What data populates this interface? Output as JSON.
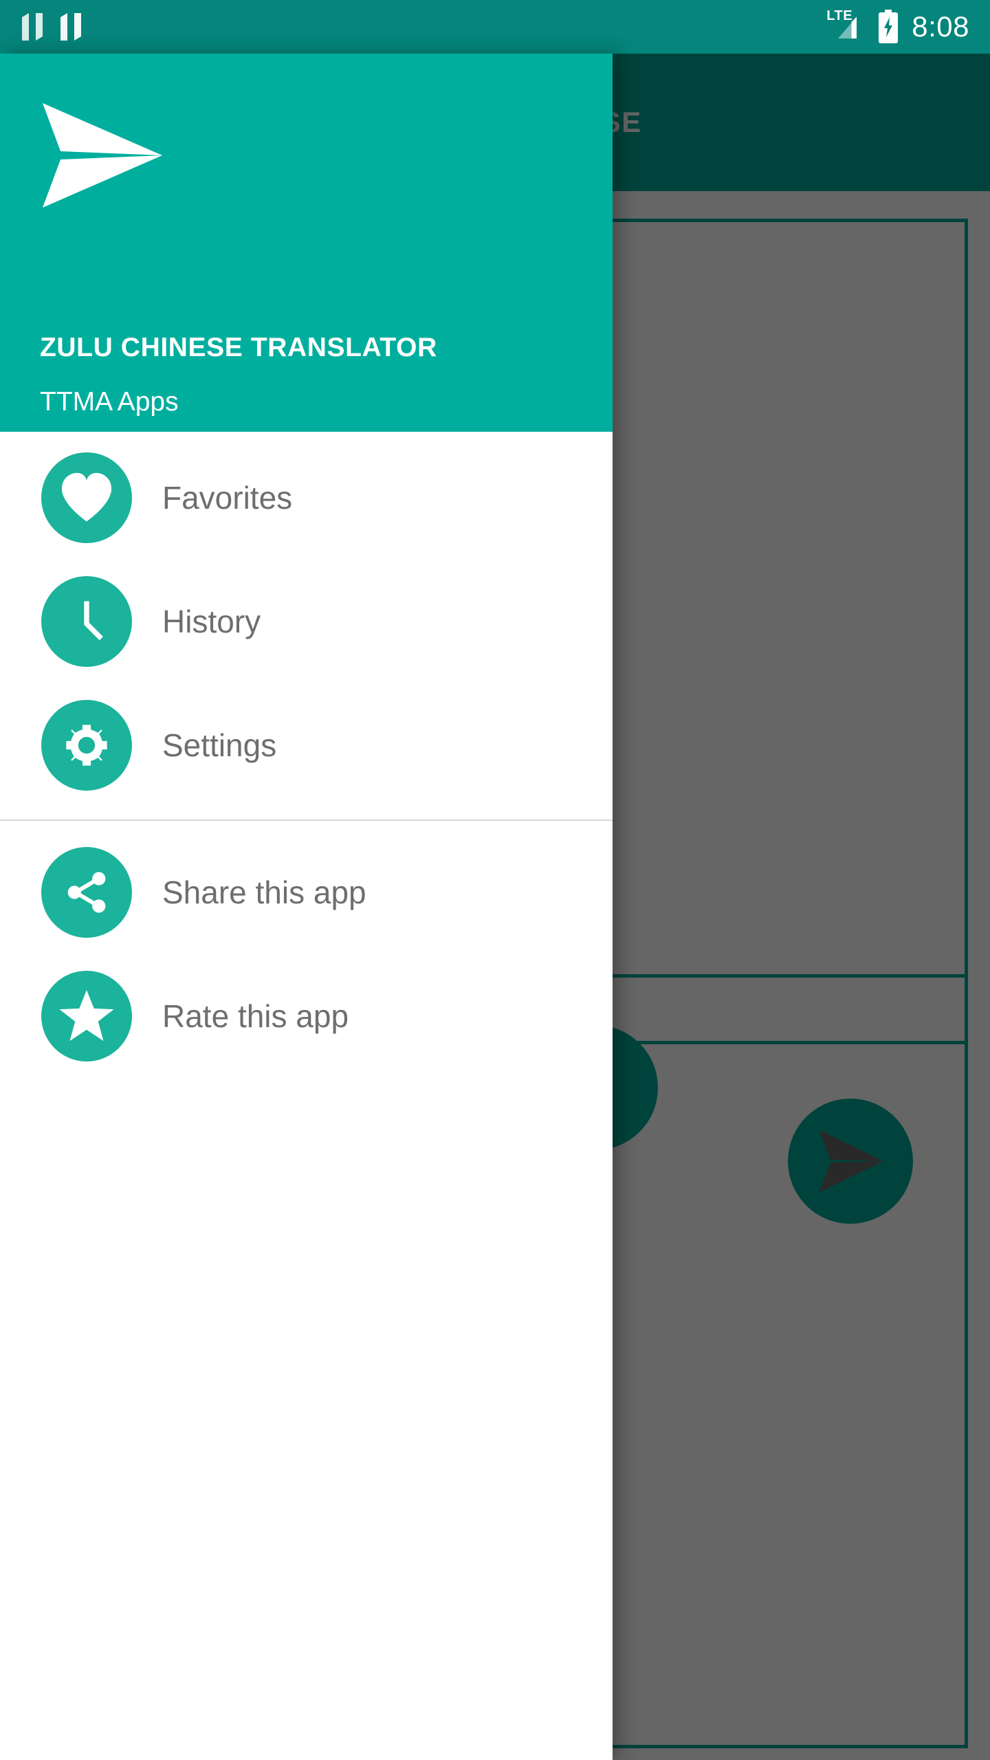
{
  "status_bar": {
    "notification_icons": [
      "android-n-icon",
      "android-n-icon"
    ],
    "network_label": "LTE",
    "battery_icon": "battery-charging-icon",
    "time": "8:08"
  },
  "app_background": {
    "toolbar": {
      "tab_label": "CHINESE"
    },
    "fab": {
      "icon": "send-icon"
    },
    "secondary_fab": {
      "icon": "send-icon"
    }
  },
  "drawer": {
    "logo_icon": "paper-plane-logo-icon",
    "app_title": "ZULU CHINESE TRANSLATOR",
    "app_subtitle": "TTMA Apps",
    "primary_items": [
      {
        "label": "Favorites",
        "icon": "heart-icon"
      },
      {
        "label": "History",
        "icon": "clock-icon"
      },
      {
        "label": "Settings",
        "icon": "gear-icon"
      }
    ],
    "secondary_items": [
      {
        "label": "Share this app",
        "icon": "share-icon"
      },
      {
        "label": "Rate this app",
        "icon": "star-icon"
      }
    ]
  },
  "colors": {
    "status_bar": "#05857B",
    "drawer_header": "#00AE9D",
    "accent": "#00A896",
    "icon_circle": "#1BB39B",
    "scrim": "rgba(0,0,0,0.60)",
    "label_text": "#6E6E6E"
  }
}
